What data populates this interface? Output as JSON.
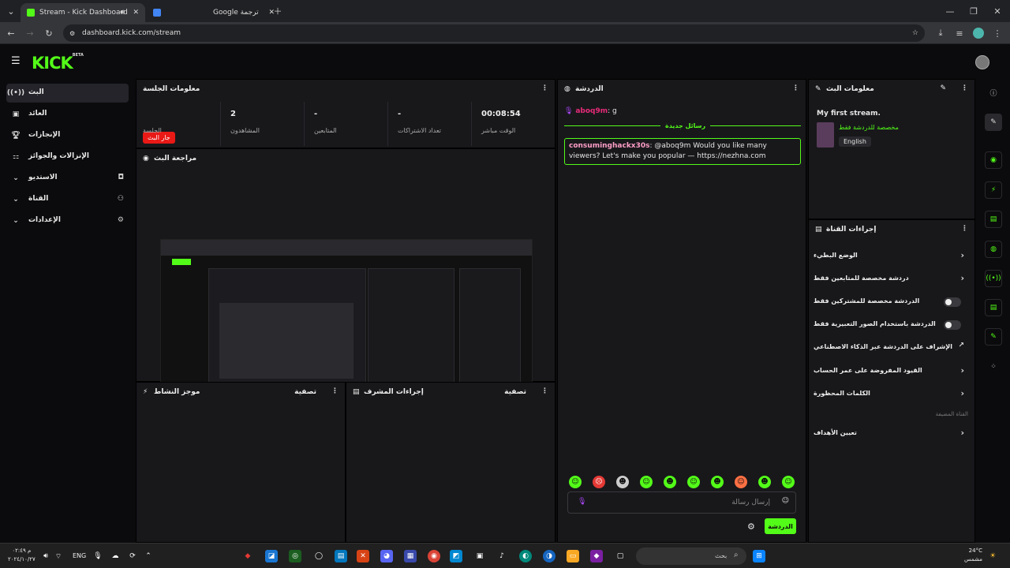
{
  "browser": {
    "tab1_title": "Stream - Kick Dashboard",
    "tab2_title": "Google ترجمة",
    "url": "dashboard.kick.com/stream"
  },
  "logo": {
    "text": "KICK",
    "beta": "BETA"
  },
  "sidebar": {
    "items": [
      {
        "label": "البث",
        "icon": "broadcast-icon",
        "active": true
      },
      {
        "label": "العائد",
        "icon": "money-icon"
      },
      {
        "label": "الإنجازات",
        "icon": "trophy-icon"
      },
      {
        "label": "الإنزالات والجوائز",
        "icon": "gift-icon"
      },
      {
        "label": "الاستديو",
        "icon": "studio-icon",
        "expandable": true
      },
      {
        "label": "القناة",
        "icon": "channel-icon",
        "expandable": true
      },
      {
        "label": "الإعدادات",
        "icon": "settings-icon",
        "expandable": true
      }
    ]
  },
  "session": {
    "title": "معلومات الجلسة",
    "live_badge": "جار البث",
    "session_label": "الجلسة",
    "viewers_value": "2",
    "viewers_label": "المشاهدون",
    "followers_value": "-",
    "followers_label": "المتابعين",
    "subs_value": "-",
    "subs_label": "تعداد الاشتراكات",
    "time_value": "00:08:54",
    "time_label": "الوقت مباشر"
  },
  "preview": {
    "title": "مراجعة البث"
  },
  "activity": {
    "title": "موجز النشاط",
    "filter": "تصفية"
  },
  "mod": {
    "title": "إجراءات المشرف",
    "filter": "تصفية"
  },
  "chat": {
    "title": "الدردشة",
    "user1": "aboq9m",
    "msg1": ": g",
    "new_messages": "رسائل جديدة",
    "user2": "consuminghackx30s",
    "msg2": ": @aboq9m Would you like many viewers? Let's make you popular — https://nezhna.com",
    "input_placeholder": "إرسال رسالة",
    "send_button": "الدردشة"
  },
  "stream_info": {
    "title": "معلومات البث",
    "stream_title": "My first stream.",
    "category": "مخصصة للدردشة فقط",
    "language": "English"
  },
  "channel_actions": {
    "title": "إجراءات القناة",
    "rows": [
      {
        "label": "الوضع البطيء",
        "type": "chevron"
      },
      {
        "label": "دردشة مخصصة للمتابعين فقط",
        "type": "chevron"
      },
      {
        "label": "الدردشة مخصصة للمشتركين فقط",
        "type": "toggle"
      },
      {
        "label": "الدردشة باستخدام الصور التعبيرية فقط",
        "type": "toggle"
      },
      {
        "label": "الإشراف على الدردشة عبر الذكاء الاصطناعي",
        "type": "external"
      },
      {
        "label": "القيود المفروضة على عمر الحساب",
        "type": "chevron"
      },
      {
        "label": "الكلمات المحظورة",
        "type": "chevron"
      }
    ],
    "section_label": "القناة المضيفة",
    "goals": "تعيين الأهداف"
  },
  "taskbar": {
    "time": "م ٠٢:٤٩",
    "date": "٢٠٢٤/١٠/٢٧",
    "lang": "ENG",
    "search": "بحث",
    "weather_temp": "24°C",
    "weather_text": "مشمس"
  }
}
